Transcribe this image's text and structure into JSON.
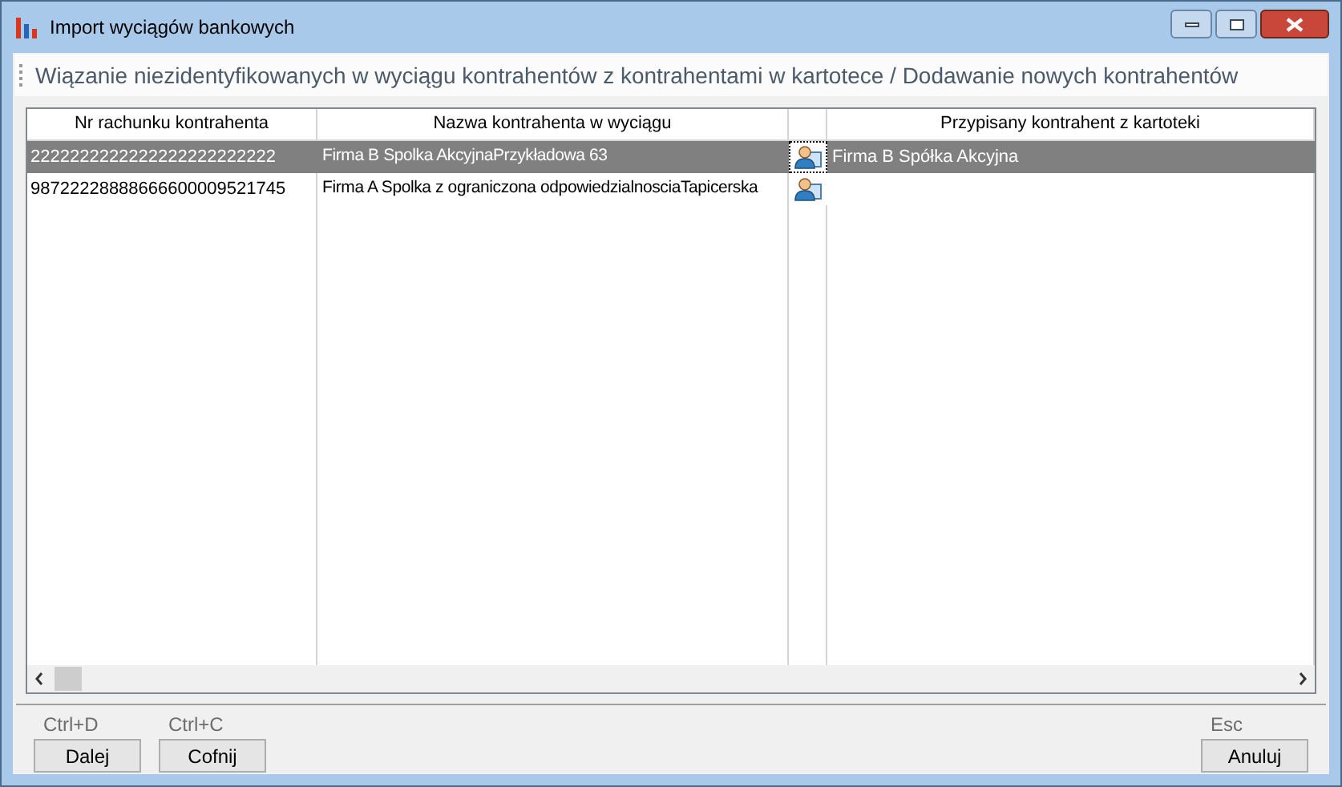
{
  "window": {
    "title": "Import wyciągów bankowych"
  },
  "header": {
    "title": "Wiązanie niezidentyfikowanych w wyciągu kontrahentów z kontrahentami w kartotece / Dodawanie nowych kontrahentów"
  },
  "table": {
    "columns": [
      {
        "kind": "text",
        "label": "Nr rachunku kontrahenta"
      },
      {
        "kind": "text",
        "label": "Nazwa kontrahenta w wyciągu"
      },
      {
        "kind": "icon"
      },
      {
        "kind": "text",
        "label": "Przypisany kontrahent z kartoteki"
      }
    ],
    "rows": [
      {
        "account": "2222222222222222222222222",
        "name": "Firma B Spolka AkcyjnaPrzykładowa 63",
        "assigned": "Firma B Spółka Akcyjna",
        "selected": true
      },
      {
        "account": "98722228888666600009521745",
        "name": "Firma A Spolka z ograniczona odpowiedzialnosciaTapicerska",
        "selected": false
      }
    ]
  },
  "buttons_left": [
    {
      "shortcut": "Ctrl+D",
      "label": "Dalej"
    },
    {
      "shortcut": "Ctrl+C",
      "label": "Cofnij"
    }
  ],
  "buttons_right": [
    {
      "shortcut": "Esc",
      "label": "Anuluj"
    }
  ]
}
